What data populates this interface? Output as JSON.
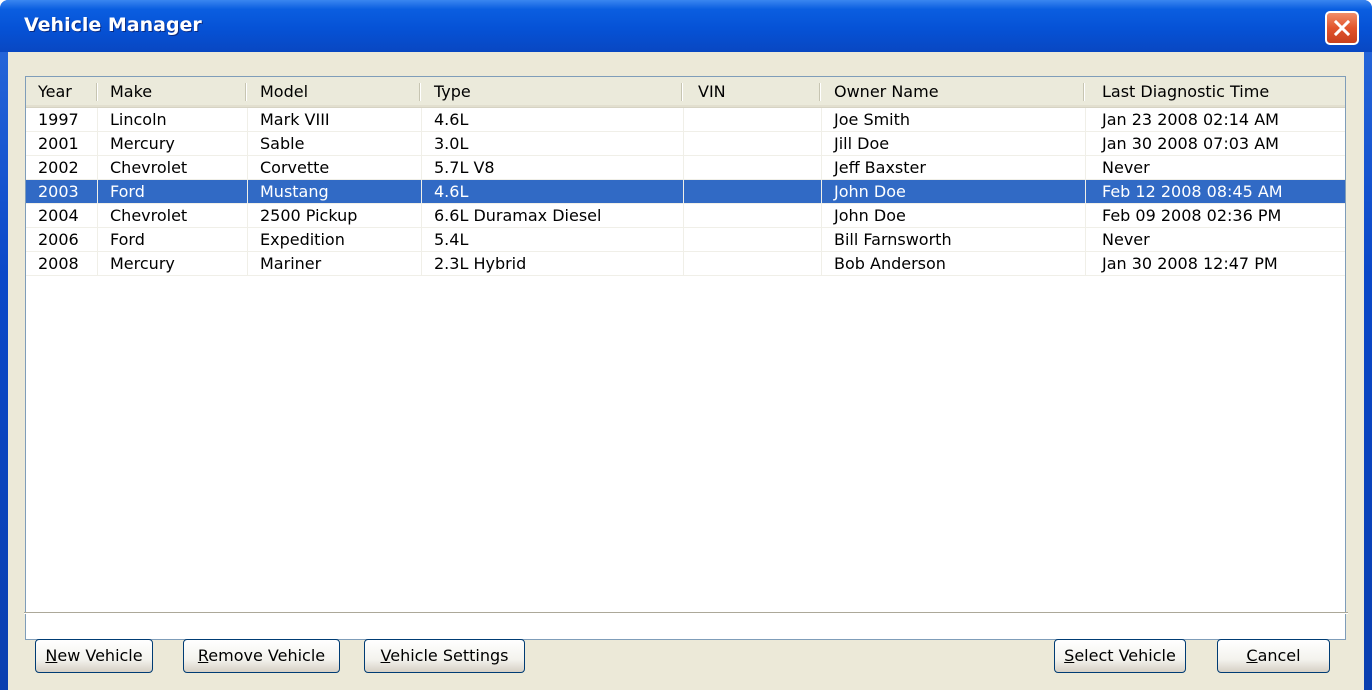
{
  "window": {
    "title": "Vehicle Manager"
  },
  "columns": [
    "Year",
    "Make",
    "Model",
    "Type",
    "VIN",
    "Owner Name",
    "Last Diagnostic Time"
  ],
  "rows": [
    [
      "1997",
      "Lincoln",
      "Mark VIII",
      "4.6L",
      "",
      "Joe Smith",
      "Jan 23 2008 02:14 AM"
    ],
    [
      "2001",
      "Mercury",
      "Sable",
      "3.0L",
      "",
      "Jill Doe",
      "Jan 30 2008 07:03 AM"
    ],
    [
      "2002",
      "Chevrolet",
      "Corvette",
      "5.7L V8",
      "",
      "Jeff Baxster",
      "Never"
    ],
    [
      "2003",
      "Ford",
      "Mustang",
      "4.6L",
      "",
      "John Doe",
      "Feb 12 2008 08:45 AM"
    ],
    [
      "2004",
      "Chevrolet",
      "2500 Pickup",
      "6.6L Duramax Diesel",
      "",
      "John Doe",
      "Feb 09 2008 02:36 PM"
    ],
    [
      "2006",
      "Ford",
      "Expedition",
      "5.4L",
      "",
      "Bill Farnsworth",
      "Never"
    ],
    [
      "2008",
      "Mercury",
      "Mariner",
      "2.3L Hybrid",
      "",
      "Bob Anderson",
      "Jan 30 2008 12:47 PM"
    ]
  ],
  "selected_row": 3,
  "buttons": {
    "new_vehicle": {
      "mnemonic": "N",
      "rest": "ew Vehicle"
    },
    "remove_vehicle": {
      "mnemonic": "R",
      "rest": "emove Vehicle"
    },
    "vehicle_settings": {
      "mnemonic": "V",
      "rest": "ehicle Settings"
    },
    "select_vehicle": {
      "mnemonic": "S",
      "rest": "elect Vehicle"
    },
    "cancel": {
      "mnemonic": "C",
      "rest": "ancel"
    }
  },
  "colors": {
    "selection": "#316ac5",
    "titlebar": "#0652d6",
    "close_button": "#e2542c",
    "dialog_face": "#ece9d8"
  }
}
